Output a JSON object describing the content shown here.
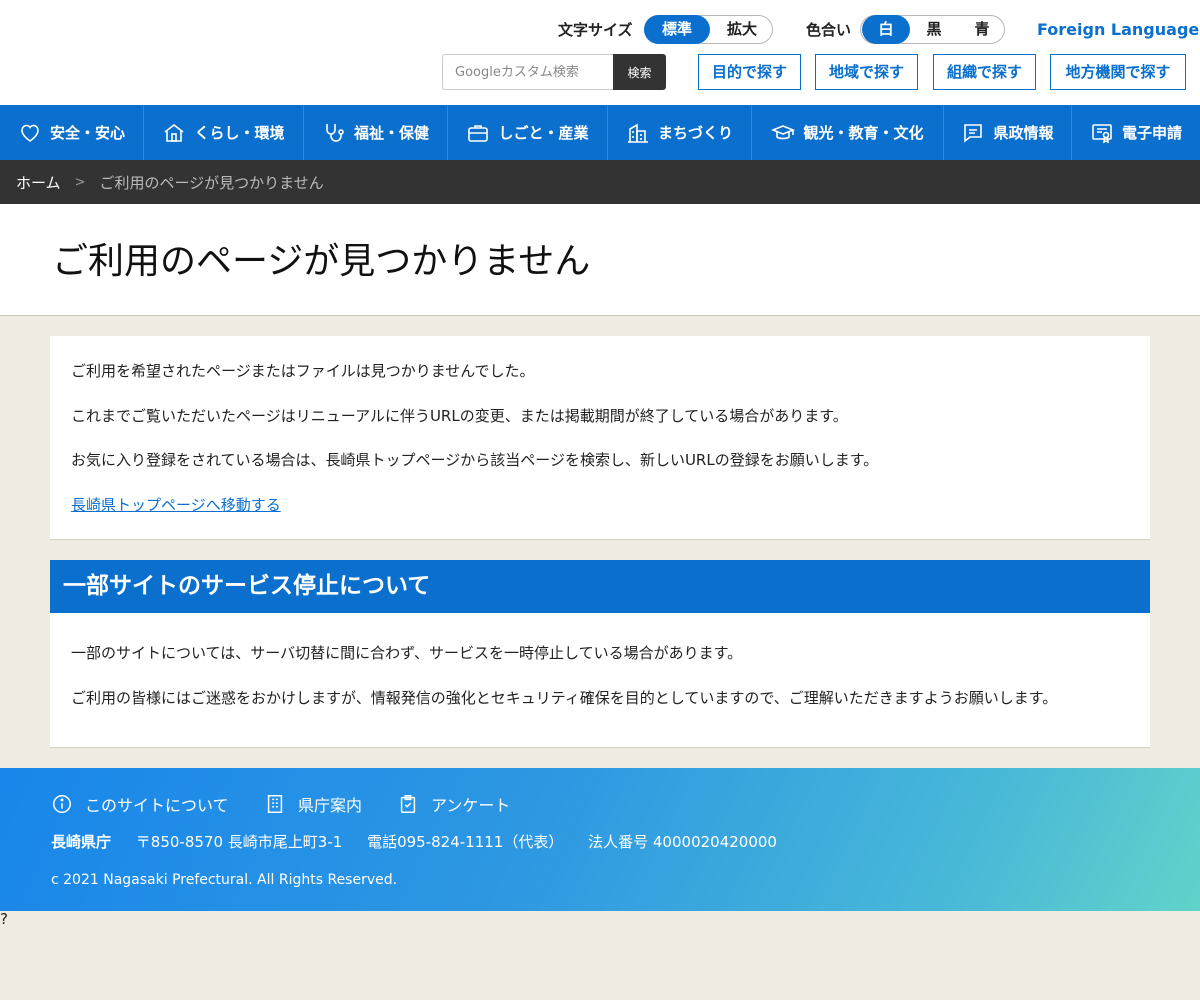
{
  "header": {
    "font_size_label": "文字サイズ",
    "font_size_options": [
      "標準",
      "拡大"
    ],
    "color_label": "色合い",
    "color_options": [
      "白",
      "黒",
      "青"
    ],
    "foreign_language": "Foreign Language",
    "search_placeholder": "Googleカスタム検索",
    "search_button": "検索",
    "find_buttons": [
      "目的で探す",
      "地域で探す",
      "組織で探す",
      "地方機関で探す"
    ]
  },
  "nav": {
    "items": [
      {
        "label": "安全・安心",
        "icon": "heart-icon"
      },
      {
        "label": "くらし・環境",
        "icon": "house-icon"
      },
      {
        "label": "福祉・保健",
        "icon": "stethoscope-icon"
      },
      {
        "label": "しごと・産業",
        "icon": "briefcase-icon"
      },
      {
        "label": "まちづくり",
        "icon": "building-icon"
      },
      {
        "label": "観光・教育・文化",
        "icon": "graduation-cap-icon"
      },
      {
        "label": "県政情報",
        "icon": "speech-bubble-icon"
      },
      {
        "label": "電子申請",
        "icon": "certificate-icon"
      }
    ]
  },
  "breadcrumb": {
    "home": "ホーム",
    "current": "ご利用のページが見つかりません"
  },
  "page": {
    "title": "ご利用のページが見つかりません"
  },
  "message": {
    "p1": "ご利用を希望されたページまたはファイルは見つかりませんでした。",
    "p2": "これまでご覧いただいたページはリニューアルに伴うURLの変更、または掲載期間が終了している場合があります。",
    "p3": "お気に入り登録をされている場合は、長崎県トップページから該当ページを検索し、新しいURLの登録をお願いします。",
    "link": "長崎県トップページへ移動する"
  },
  "notice": {
    "heading": "一部サイトのサービス停止について",
    "p1": "一部のサイトについては、サーバ切替に間に合わず、サービスを一時停止している場合があります。",
    "p2": "ご利用の皆様にはご迷惑をおかけしますが、情報発信の強化とセキュリティ確保を目的としていますので、ご理解いただきますようお願いします。"
  },
  "footer": {
    "links": [
      "このサイトについて",
      "県庁案内",
      "アンケート"
    ],
    "org": "長崎県庁",
    "address": "〒850-8570 長崎市尾上町3-1",
    "phone": "電話095-824-1111（代表）",
    "corp_number": "法人番号 4000020420000",
    "copyright": "c 2021 Nagasaki Prefectural. All Rights Reserved."
  },
  "stray_char": "?",
  "colors": {
    "primary_blue": "#0a6fcd",
    "breadcrumb_bg": "#333333",
    "page_bg": "#f0ebe0"
  }
}
